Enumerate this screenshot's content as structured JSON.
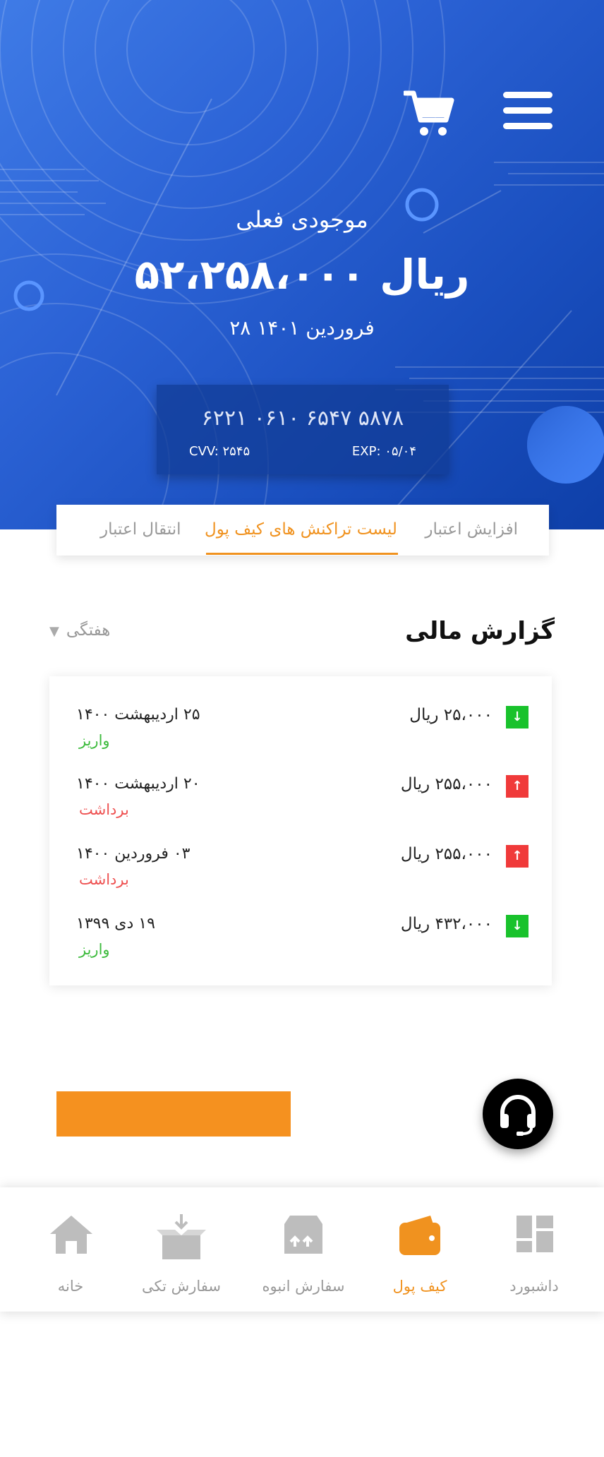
{
  "header": {
    "balance_label": "موجودی فعلی",
    "balance_value": "۵۲،۲۵۸،۰۰۰ ریال",
    "balance_date": "۲۸ فروردین ۱۴۰۱",
    "menu_icon": "hamburger-menu-icon",
    "cart_icon": "shopping-cart-icon"
  },
  "card": {
    "number": "۶۲۲۱   ۰۶۱۰   ۶۵۴۷   ۵۸۷۸",
    "cvv": "CVV: ۲۵۴۵",
    "exp": "EXP: ۰۵/۰۴"
  },
  "tabs": {
    "increase_credit": "افزایش اعتبار",
    "wallet_transactions": "لیست تراکنش های کیف پول",
    "transfer_credit": "انتقال اعتبار",
    "active": "wallet_transactions"
  },
  "report": {
    "title": "گزارش مالی",
    "period": "هفتگی",
    "rows": [
      {
        "amount": "۲۵،۰۰۰ ریال",
        "date": "۲۵ اردیبهشت ۱۴۰۰",
        "type": "واریز",
        "direction": "in"
      },
      {
        "amount": "۲۵۵،۰۰۰ ریال",
        "date": "۲۰ اردیبهشت ۱۴۰۰",
        "type": "برداشت",
        "direction": "out"
      },
      {
        "amount": "۲۵۵،۰۰۰ ریال",
        "date": "۰۳ فروردین ۱۴۰۰",
        "type": "برداشت",
        "direction": "out"
      },
      {
        "amount": "۴۳۲،۰۰۰ ریال",
        "date": "۱۹ دی ۱۳۹۹",
        "type": "واریز",
        "direction": "in"
      }
    ]
  },
  "nav": {
    "dashboard": "داشبورد",
    "wallet": "کیف پول",
    "bulk_order": "سفارش انبوه",
    "single_order": "سفارش تکی",
    "home": "خانه",
    "active": "wallet"
  },
  "colors": {
    "accent": "#f0921f",
    "deposit": "#19c22c",
    "withdraw": "#f03a3a",
    "hero_blue": "#2c63d6"
  }
}
